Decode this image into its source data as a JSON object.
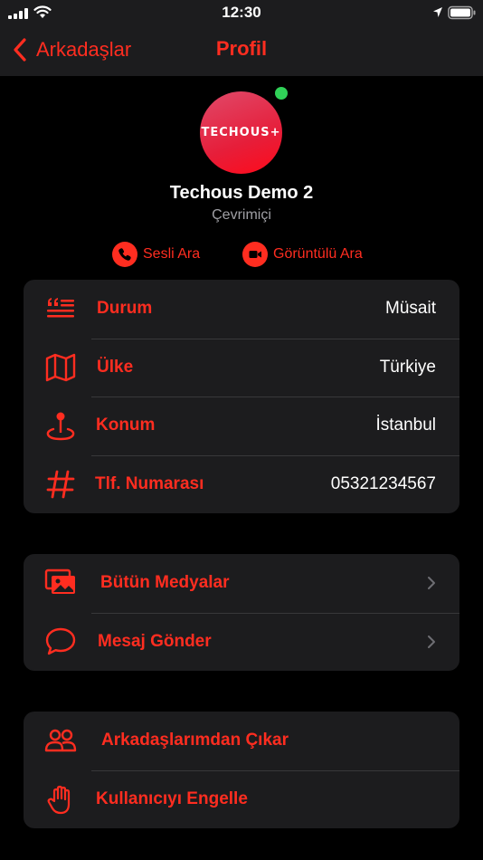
{
  "status_bar": {
    "time": "12:30"
  },
  "nav": {
    "back_label": "Arkadaşlar",
    "title": "Profil"
  },
  "profile": {
    "avatar_text": "TECHOUS+",
    "name": "Techous Demo 2",
    "presence": "Çevrimiçi"
  },
  "calls": {
    "voice_label": "Sesli Ara",
    "video_label": "Görüntülü Ara"
  },
  "info": [
    {
      "label": "Durum",
      "value": "Müsait",
      "icon": "quote-icon"
    },
    {
      "label": "Ülke",
      "value": "Türkiye",
      "icon": "map-icon"
    },
    {
      "label": "Konum",
      "value": "İstanbul",
      "icon": "location-pin-icon"
    },
    {
      "label": "Tlf. Numarası",
      "value": "05321234567",
      "icon": "hash-icon"
    }
  ],
  "actions": [
    {
      "label": "Bütün Medyalar",
      "icon": "media-icon"
    },
    {
      "label": "Mesaj Gönder",
      "icon": "chat-bubble-icon"
    }
  ],
  "danger": [
    {
      "label": "Arkadaşlarımdan Çıkar",
      "icon": "users-icon"
    },
    {
      "label": "Kullanıcıyı Engelle",
      "icon": "hand-icon"
    }
  ],
  "colors": {
    "accent": "#ff2d20",
    "online": "#30d158",
    "card": "#1c1c1e",
    "background": "#000000"
  }
}
